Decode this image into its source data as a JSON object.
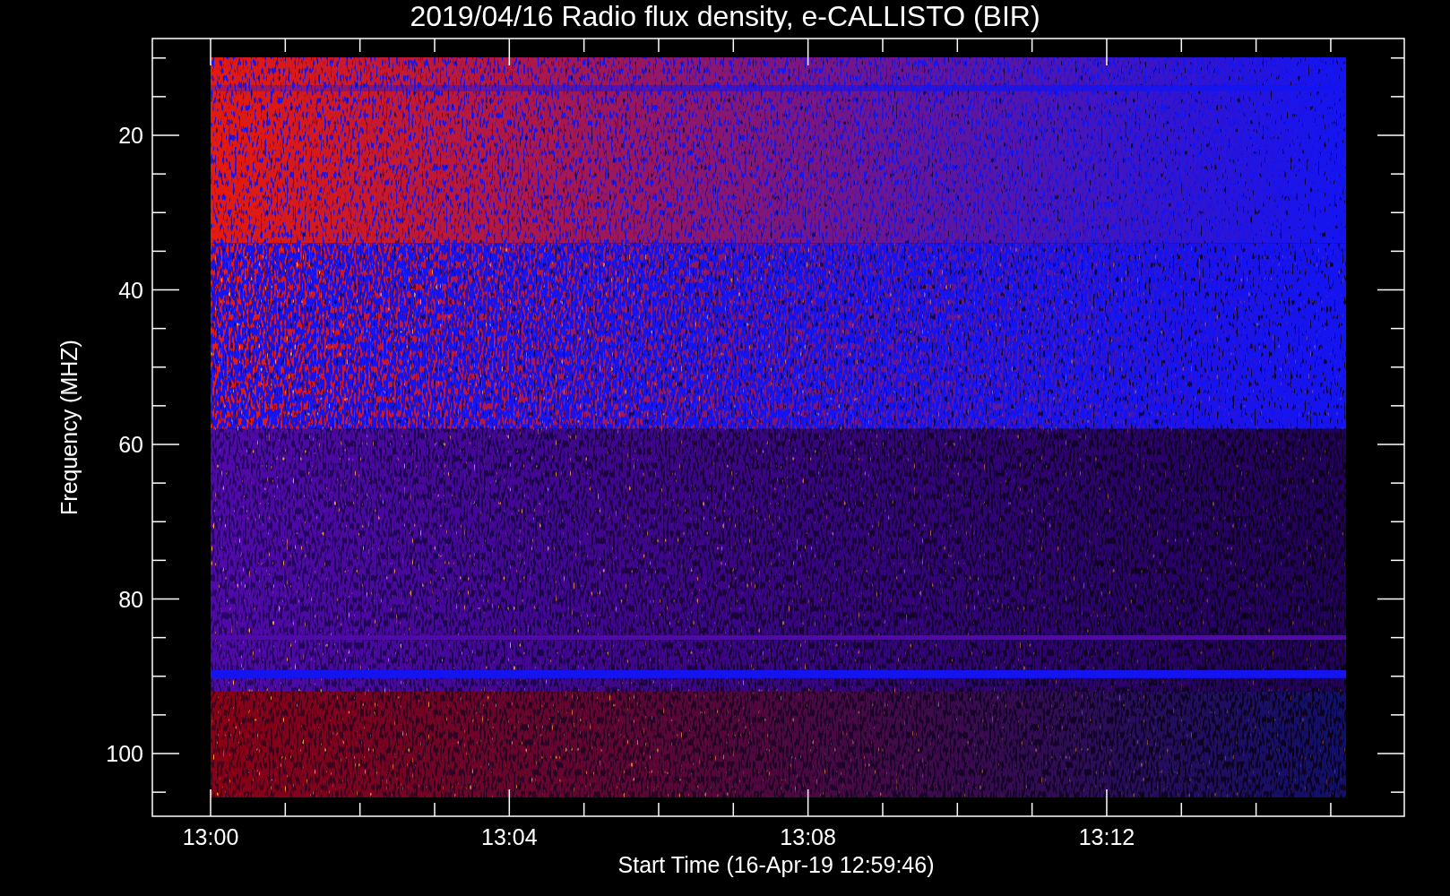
{
  "title": "2019/04/16  Radio flux density, e-CALLISTO (BIR)",
  "y_axis": {
    "label": "Frequency (MHZ)",
    "ticks": [
      "20",
      "40",
      "60",
      "80",
      "100"
    ]
  },
  "x_axis": {
    "label": "Start Time (16-Apr-19 12:59:46)",
    "ticks": [
      "13:00",
      "13:04",
      "13:08",
      "13:12"
    ]
  }
}
